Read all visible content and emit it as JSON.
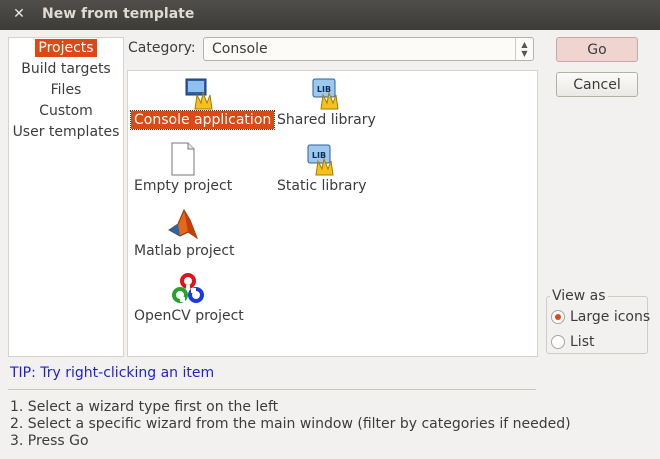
{
  "window": {
    "title": "New from template",
    "close_glyph": "✕"
  },
  "categories": {
    "items": [
      {
        "label": "Projects",
        "selected": true
      },
      {
        "label": "Build targets",
        "selected": false
      },
      {
        "label": "Files",
        "selected": false
      },
      {
        "label": "Custom",
        "selected": false
      },
      {
        "label": "User templates",
        "selected": false
      }
    ]
  },
  "category_select": {
    "label": "Category:",
    "value": "Console"
  },
  "templates": {
    "items": [
      {
        "label": "Console application",
        "icon": "console-app-icon",
        "selected": true
      },
      {
        "label": "Shared library",
        "icon": "shared-library-icon",
        "selected": false
      },
      {
        "label": "Empty project",
        "icon": "empty-project-icon",
        "selected": false
      },
      {
        "label": "Static library",
        "icon": "static-library-icon",
        "selected": false
      },
      {
        "label": "Matlab project",
        "icon": "matlab-icon",
        "selected": false
      },
      {
        "label": "OpenCV project",
        "icon": "opencv-icon",
        "selected": false
      }
    ]
  },
  "tip": "TIP: Try right-clicking an item",
  "steps": [
    "1. Select a wizard type first on the left",
    "2. Select a specific wizard from the main window (filter by categories if needed)",
    "3. Press Go"
  ],
  "buttons": {
    "go": "Go",
    "cancel": "Cancel"
  },
  "view_as": {
    "legend": "View as",
    "options": [
      {
        "label": "Large icons",
        "selected": true
      },
      {
        "label": "List",
        "selected": false
      }
    ]
  },
  "colors": {
    "accent": "#dd4814",
    "tip": "#1f1fd6"
  }
}
